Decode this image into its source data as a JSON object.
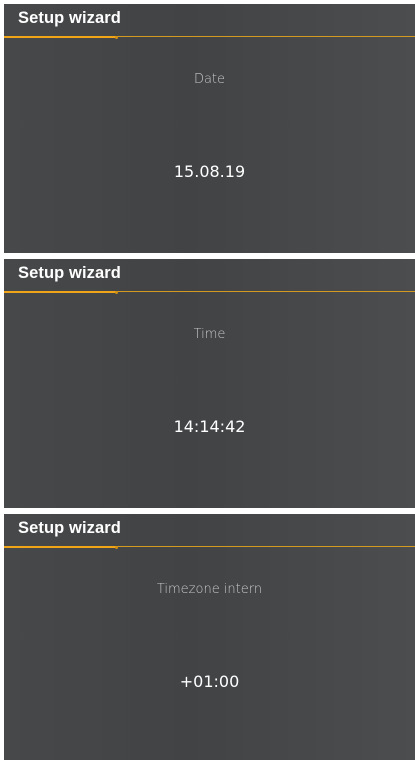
{
  "screens": [
    {
      "header_title": "Setup wizard",
      "field_label": "Date",
      "field_value": "15.08.19"
    },
    {
      "header_title": "Setup wizard",
      "field_label": "Time",
      "field_value": "14:14:42"
    },
    {
      "header_title": "Setup wizard",
      "field_label": "Timezone intern",
      "field_value": "+01:00"
    }
  ],
  "colors": {
    "accent": "#f0a417",
    "background": "#444648",
    "text_primary": "#ffffff",
    "text_secondary": "#c8c8c8"
  }
}
